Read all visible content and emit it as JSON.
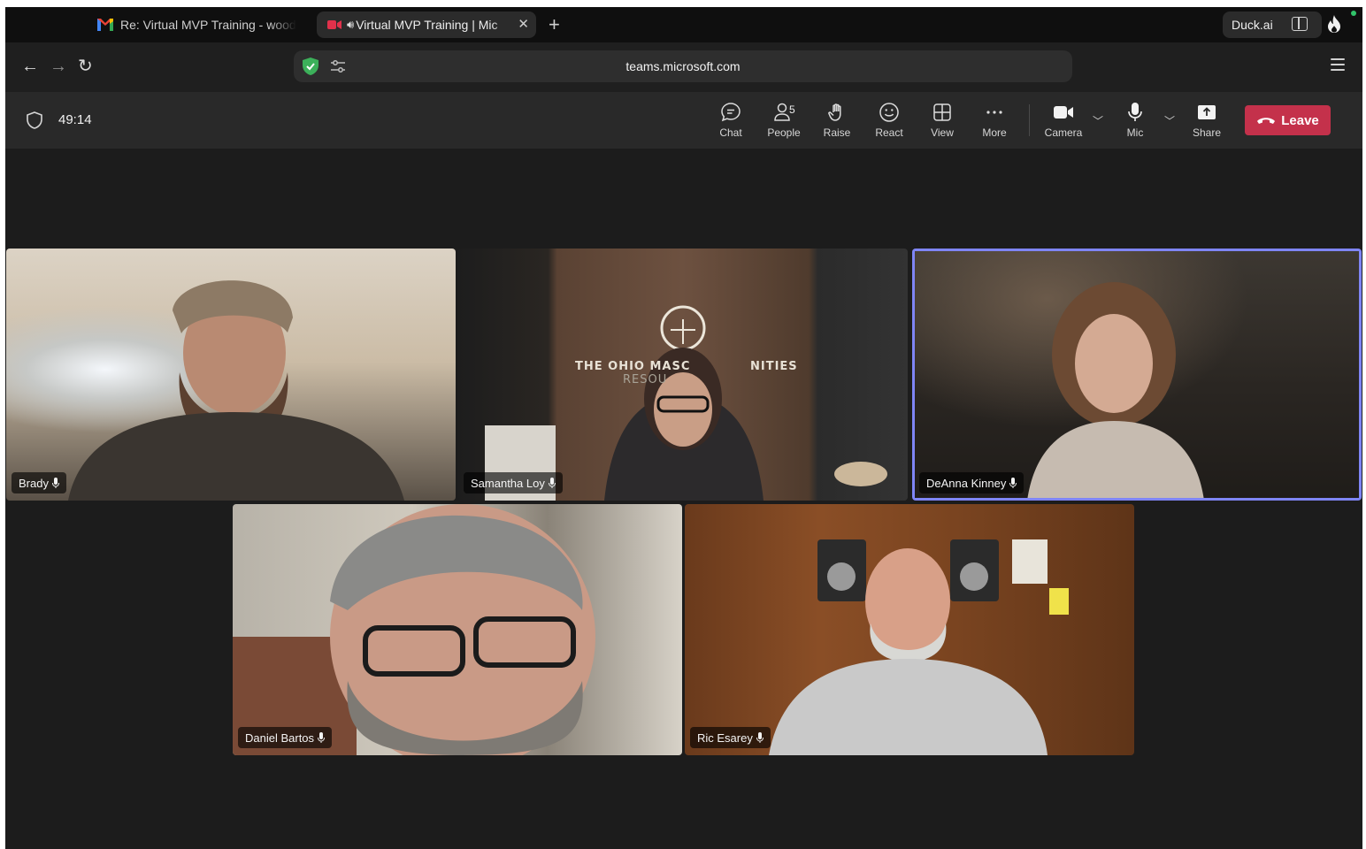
{
  "browser": {
    "tabs": [
      {
        "title": "Re: Virtual MVP Training - wood",
        "icon": "gmail-icon",
        "active": false
      },
      {
        "title": "Virtual MVP Training | Mic",
        "icon": "teams-video-icon",
        "active": true
      }
    ],
    "new_tab": "+",
    "close_tab": "✕",
    "duck_ai": "Duck.ai",
    "url": "teams.microsoft.com"
  },
  "meeting": {
    "timer": "49:14",
    "toolbar": {
      "chat": "Chat",
      "people": "People",
      "people_count": "5",
      "raise": "Raise",
      "react": "React",
      "view": "View",
      "more": "More",
      "camera": "Camera",
      "mic": "Mic",
      "share": "Share",
      "leave": "Leave"
    },
    "participants": [
      {
        "name": "Brady",
        "active_speaker": false
      },
      {
        "name": "Samantha Loy",
        "active_speaker": false,
        "background_text": "THE OHIO MASC",
        "background_text_2": "NITIES",
        "background_text_3": "RESOU"
      },
      {
        "name": "DeAnna Kinney",
        "active_speaker": true
      },
      {
        "name": "Daniel Bartos",
        "active_speaker": false
      },
      {
        "name": "Ric Esarey",
        "active_speaker": false
      }
    ],
    "colors": {
      "leave": "#c4314b",
      "active_speaker_border": "#7f85f5"
    }
  }
}
